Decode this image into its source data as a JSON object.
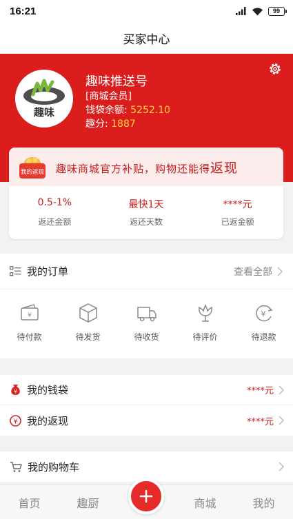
{
  "status_bar": {
    "time": "16:21",
    "battery": "99"
  },
  "nav": {
    "title": "买家中心"
  },
  "profile": {
    "shop_name": "趣味推送号",
    "member_tag": "[商城会员]",
    "wallet_label": "钱袋余额: ",
    "wallet_value": "5252.10",
    "points_label": "趣分: ",
    "points_value": "1887",
    "avatar_text": "趣味"
  },
  "cashback": {
    "badge_text": "我的返现",
    "slogan": "趣味商城官方补贴，购物还能得",
    "slogan_big": "返现",
    "stats": [
      {
        "value": "0.5-1%",
        "label": "返还金额"
      },
      {
        "value": "最快1天",
        "label": "返还天数"
      },
      {
        "value": "****元",
        "label": "已返金额"
      }
    ]
  },
  "orders": {
    "title": "我的订单",
    "view_all": "查看全部",
    "items": [
      {
        "label": "待付款",
        "icon": "wallet-icon"
      },
      {
        "label": "待发货",
        "icon": "box-icon"
      },
      {
        "label": "待收货",
        "icon": "truck-icon"
      },
      {
        "label": "待评价",
        "icon": "flower-icon"
      },
      {
        "label": "待退款",
        "icon": "refund-icon"
      }
    ]
  },
  "rows": [
    {
      "label": "我的钱袋",
      "value": "****元",
      "icon": "money-bag-icon"
    },
    {
      "label": "我的返现",
      "value": "****元",
      "icon": "yuan-circle-icon"
    },
    {
      "label": "我的购物车",
      "value": "",
      "icon": "cart-icon"
    }
  ],
  "tabbar": {
    "tabs": [
      "首页",
      "趣厨",
      "商城",
      "我的"
    ],
    "center_icon": "plus-icon"
  },
  "colors": {
    "brand_red": "#dc1d1d",
    "highlight_yellow": "#ffd23c",
    "price_red": "#c71b1b"
  }
}
